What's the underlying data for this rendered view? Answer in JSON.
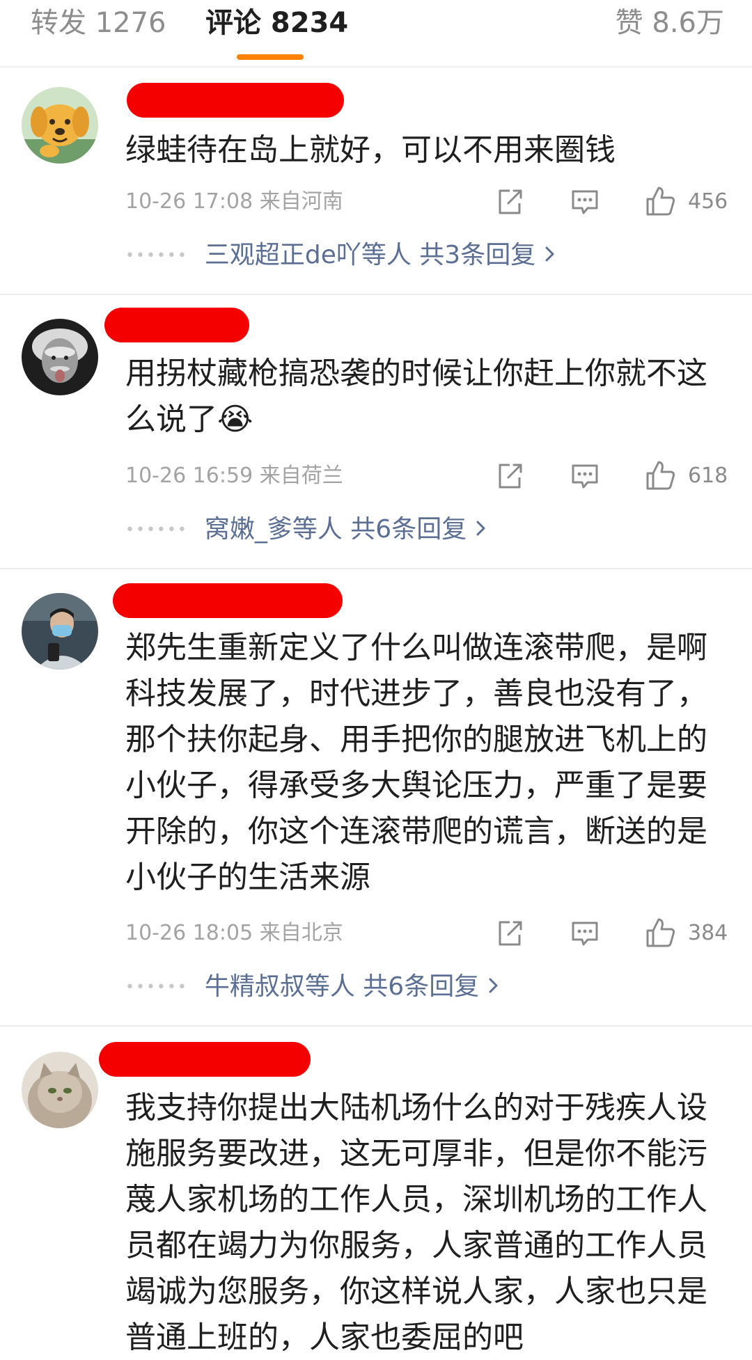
{
  "tabs": {
    "repost": "转发 1276",
    "comment": "评论 8234",
    "like": "赞 8.6万"
  },
  "comments": [
    {
      "text": "绿蛙待在岛上就好，可以不用来圈钱",
      "meta": "10-26 17:08 来自河南",
      "likes": "456",
      "replies": "三观超正de吖等人  共3条回复",
      "avatar": "cartoon-dog-avatar"
    },
    {
      "text": "用拐杖藏枪搞恐袭的时候让你赶上你就不这么说了😭",
      "meta": "10-26 16:59 来自荷兰",
      "likes": "618",
      "replies": "窝嫩_爹等人  共6条回复",
      "avatar": "einstein-photo-avatar"
    },
    {
      "text": "郑先生重新定义了什么叫做连滚带爬，是啊科技发展了，时代进步了，善良也没有了，那个扶你起身、用手把你的腿放进飞机上的小伙子，得承受多大舆论压力，严重了是要开除的，你这个连滚带爬的谎言，断送的是小伙子的生活来源",
      "meta": "10-26 18:05 来自北京",
      "likes": "384",
      "replies": "牛精叔叔等人  共6条回复",
      "avatar": "masked-selfie-avatar"
    },
    {
      "text": "我支持你提出大陆机场什么的对于残疾人设施服务要改进，这无可厚非，但是你不能污蔑人家机场的工作人员，深圳机场的工作人员都在竭力为你服务，人家普通的工作人员竭诚为您服务，你这样说人家，人家也只是普通上班的，人家也委屈的吧",
      "avatar": "persian-cat-avatar"
    }
  ],
  "colors": {
    "accent": "#ff8200",
    "link": "#5b6f95",
    "redaction": "#f40000"
  }
}
